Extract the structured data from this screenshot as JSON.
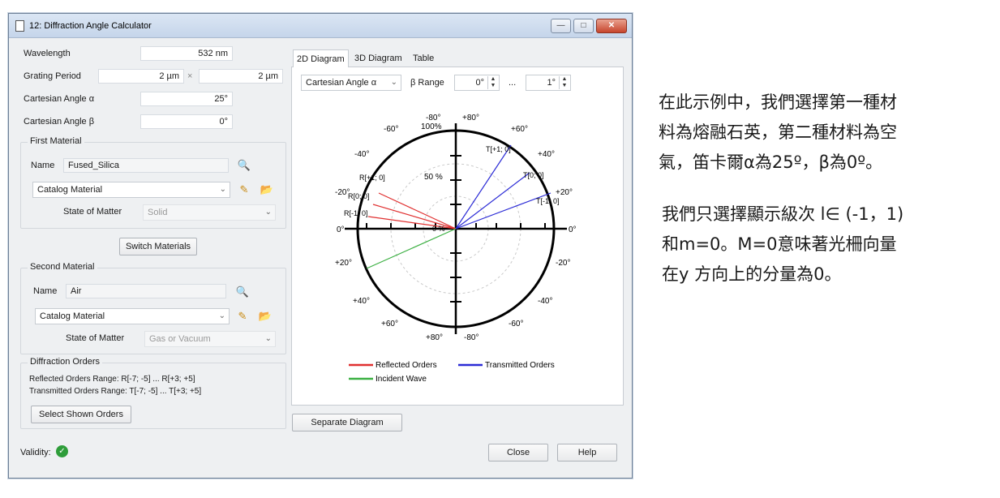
{
  "window": {
    "title": "12: Diffraction Angle Calculator",
    "min": "—",
    "max": "□",
    "close": "✕"
  },
  "params": {
    "wavelength_label": "Wavelength",
    "wavelength_value": "532 nm",
    "grating_label": "Grating Period",
    "grating_value1": "2 µm",
    "grating_times": "×",
    "grating_value2": "2 µm",
    "alpha_label": "Cartesian Angle α",
    "alpha_value": "25°",
    "beta_label": "Cartesian Angle β",
    "beta_value": "0°"
  },
  "first_material": {
    "title": "First Material",
    "name_label": "Name",
    "name_value": "Fused_Silica",
    "catalog": "Catalog Material",
    "state_label": "State of Matter",
    "state_value": "Solid"
  },
  "switch_button": "Switch Materials",
  "second_material": {
    "title": "Second Material",
    "name_label": "Name",
    "name_value": "Air",
    "catalog": "Catalog Material",
    "state_label": "State of Matter",
    "state_value": "Gas or Vacuum"
  },
  "diffraction_orders": {
    "title": "Diffraction Orders",
    "reflected": "Reflected Orders Range: R[-7; -5] ... R[+3; +5]",
    "transmitted": "Transmitted Orders Range: T[-7; -5] ... T[+3; +5]",
    "select_button": "Select Shown Orders"
  },
  "validity_label": "Validity:",
  "tabs": [
    "2D Diagram",
    "3D Diagram",
    "Table"
  ],
  "toolbar": {
    "angle_select": "Cartesian Angle α",
    "beta_range_label": "β Range",
    "beta_from": "0°",
    "range_sep": "...",
    "beta_to": "1°"
  },
  "diagram_labels": {
    "top_m80": "-80°",
    "top_p80": "+80°",
    "top_100": "100%",
    "m60_tl": "-60°",
    "p60_tr": "+60°",
    "m40_l": "-40°",
    "p40_r": "+40°",
    "m20_l": "-20°",
    "p20_r": "+20°",
    "zero_l": "0°",
    "zero_r": "0°",
    "p20_bl": "+20°",
    "m20_br": "-20°",
    "p40_bl": "+40°",
    "m40_br": "-40°",
    "p60_bl": "+60°",
    "m60_br": "-60°",
    "bot_p80": "+80°",
    "bot_m80": "-80°",
    "pct50": "50 %",
    "pct0": "0 %",
    "R_m1": "R[-1; 0]",
    "R_0": "R[0; 0]",
    "R_p1": "R[+1; 0]",
    "T_m1": "T[-1; 0]",
    "T_0": "T[0; 0]",
    "T_p1": "T[+1; 0]"
  },
  "legend": {
    "reflected": "Reflected Orders",
    "transmitted": "Transmitted Orders",
    "incident": "Incident Wave"
  },
  "colors": {
    "reflected": "#e03030",
    "transmitted": "#2b2bd6",
    "incident": "#3cb043",
    "validity": "#2e9d3a"
  },
  "separate_button": "Separate Diagram",
  "close_button": "Close",
  "help_button": "Help",
  "side_text": {
    "p1": [
      "在此示例中，我們選擇第一種材",
      "料為熔融石英，第二種材料為空",
      "氣，笛卡爾α為25º，β為0º。"
    ],
    "p2": [
      "我們只選擇顯示級次 l∈ (-1，1)",
      "和m=0。M=0意味著光柵向量",
      "在y 方向上的分量為0。"
    ]
  }
}
